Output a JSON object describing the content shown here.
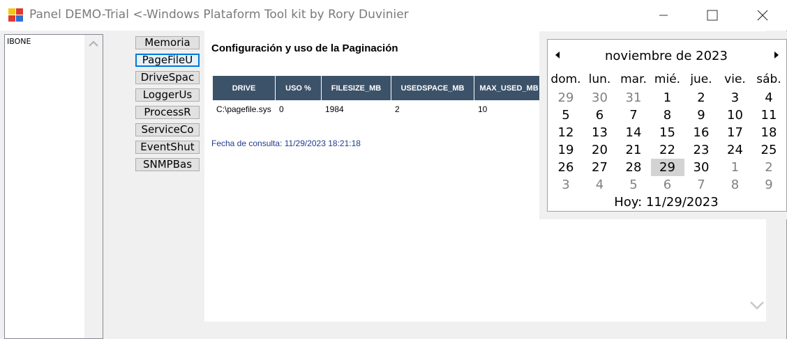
{
  "window": {
    "title": "Panel DEMO-Trial <-Windows Plataform Tool kit by Rory Duvinier",
    "icon": "app-color-squares-icon"
  },
  "listbox": {
    "items": [
      "IBONE"
    ]
  },
  "nav_buttons": [
    "Memoria",
    "PageFileU",
    "DriveSpac",
    "LoggerUs",
    "ProcessR",
    "ServiceCo",
    "EventShut",
    "SNMPBas"
  ],
  "nav_focused": "PageFileU",
  "main": {
    "title": "Configuración y uso de la Paginación",
    "columns": [
      "DRIVE",
      "USO %",
      "FILESIZE_MB",
      "USEDSPACE_MB",
      "MAX_USED_MB"
    ],
    "rows": [
      [
        "C:\\pagefile.sys",
        "0",
        "1984",
        "2",
        "10"
      ]
    ],
    "fecha": "Fecha de consulta: 11/29/2023 18:21:18"
  },
  "calendar": {
    "month_label": "noviembre de 2023",
    "days_of_week": [
      "dom.",
      "lun.",
      "mar.",
      "mié.",
      "jue.",
      "vie.",
      "sáb."
    ],
    "weeks": [
      [
        "29",
        "30",
        "31",
        "1",
        "2",
        "3",
        "4"
      ],
      [
        "5",
        "6",
        "7",
        "8",
        "9",
        "10",
        "11"
      ],
      [
        "12",
        "13",
        "14",
        "15",
        "16",
        "17",
        "18"
      ],
      [
        "19",
        "20",
        "21",
        "22",
        "23",
        "24",
        "25"
      ],
      [
        "26",
        "27",
        "28",
        "29",
        "30",
        "1",
        "2"
      ],
      [
        "3",
        "4",
        "5",
        "6",
        "7",
        "8",
        "9"
      ]
    ],
    "today_label": "Hoy: 11/29/2023",
    "selected_day": "29"
  },
  "colors": {
    "grid_header_bg": "#3c5269",
    "fecha_text": "#1f3c8c",
    "focus_border": "#0078d7"
  }
}
